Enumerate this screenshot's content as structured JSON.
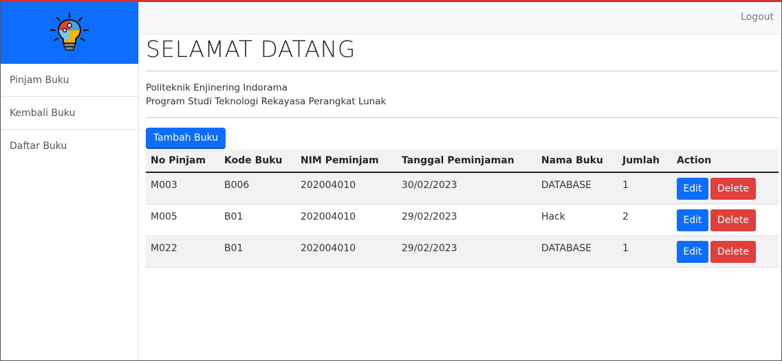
{
  "app": {
    "logo_icon": "lightbulb-puzzle-icon",
    "accent_color": "#0d6efd",
    "danger_color": "#e0403d"
  },
  "sidebar": {
    "items": [
      {
        "label": "Pinjam Buku"
      },
      {
        "label": "Kembali Buku"
      },
      {
        "label": "Daftar Buku"
      }
    ]
  },
  "topbar": {
    "logout_label": "Logout"
  },
  "main": {
    "title": "SELAMAT DATANG",
    "info_line1": "Politeknik Enjinering Indorama",
    "info_line2": "Program Studi Teknologi Rekayasa Perangkat Lunak",
    "add_button_label": "Tambah Buku"
  },
  "table": {
    "headers": [
      "No Pinjam",
      "Kode Buku",
      "NIM Peminjam",
      "Tanggal Peminjaman",
      "Nama Buku",
      "Jumlah",
      "Action"
    ],
    "rows": [
      {
        "no": "M003",
        "kode": "B006",
        "nim": "202004010",
        "tanggal": "30/02/2023",
        "nama": "DATABASE",
        "jumlah": "1"
      },
      {
        "no": "M005",
        "kode": "B01",
        "nim": "202004010",
        "tanggal": "29/02/2023",
        "nama": "Hack",
        "jumlah": "2"
      },
      {
        "no": "M022",
        "kode": "B01",
        "nim": "202004010",
        "tanggal": "29/02/2023",
        "nama": "DATABASE",
        "jumlah": "1"
      }
    ],
    "edit_label": "Edit",
    "delete_label": "Delete"
  }
}
